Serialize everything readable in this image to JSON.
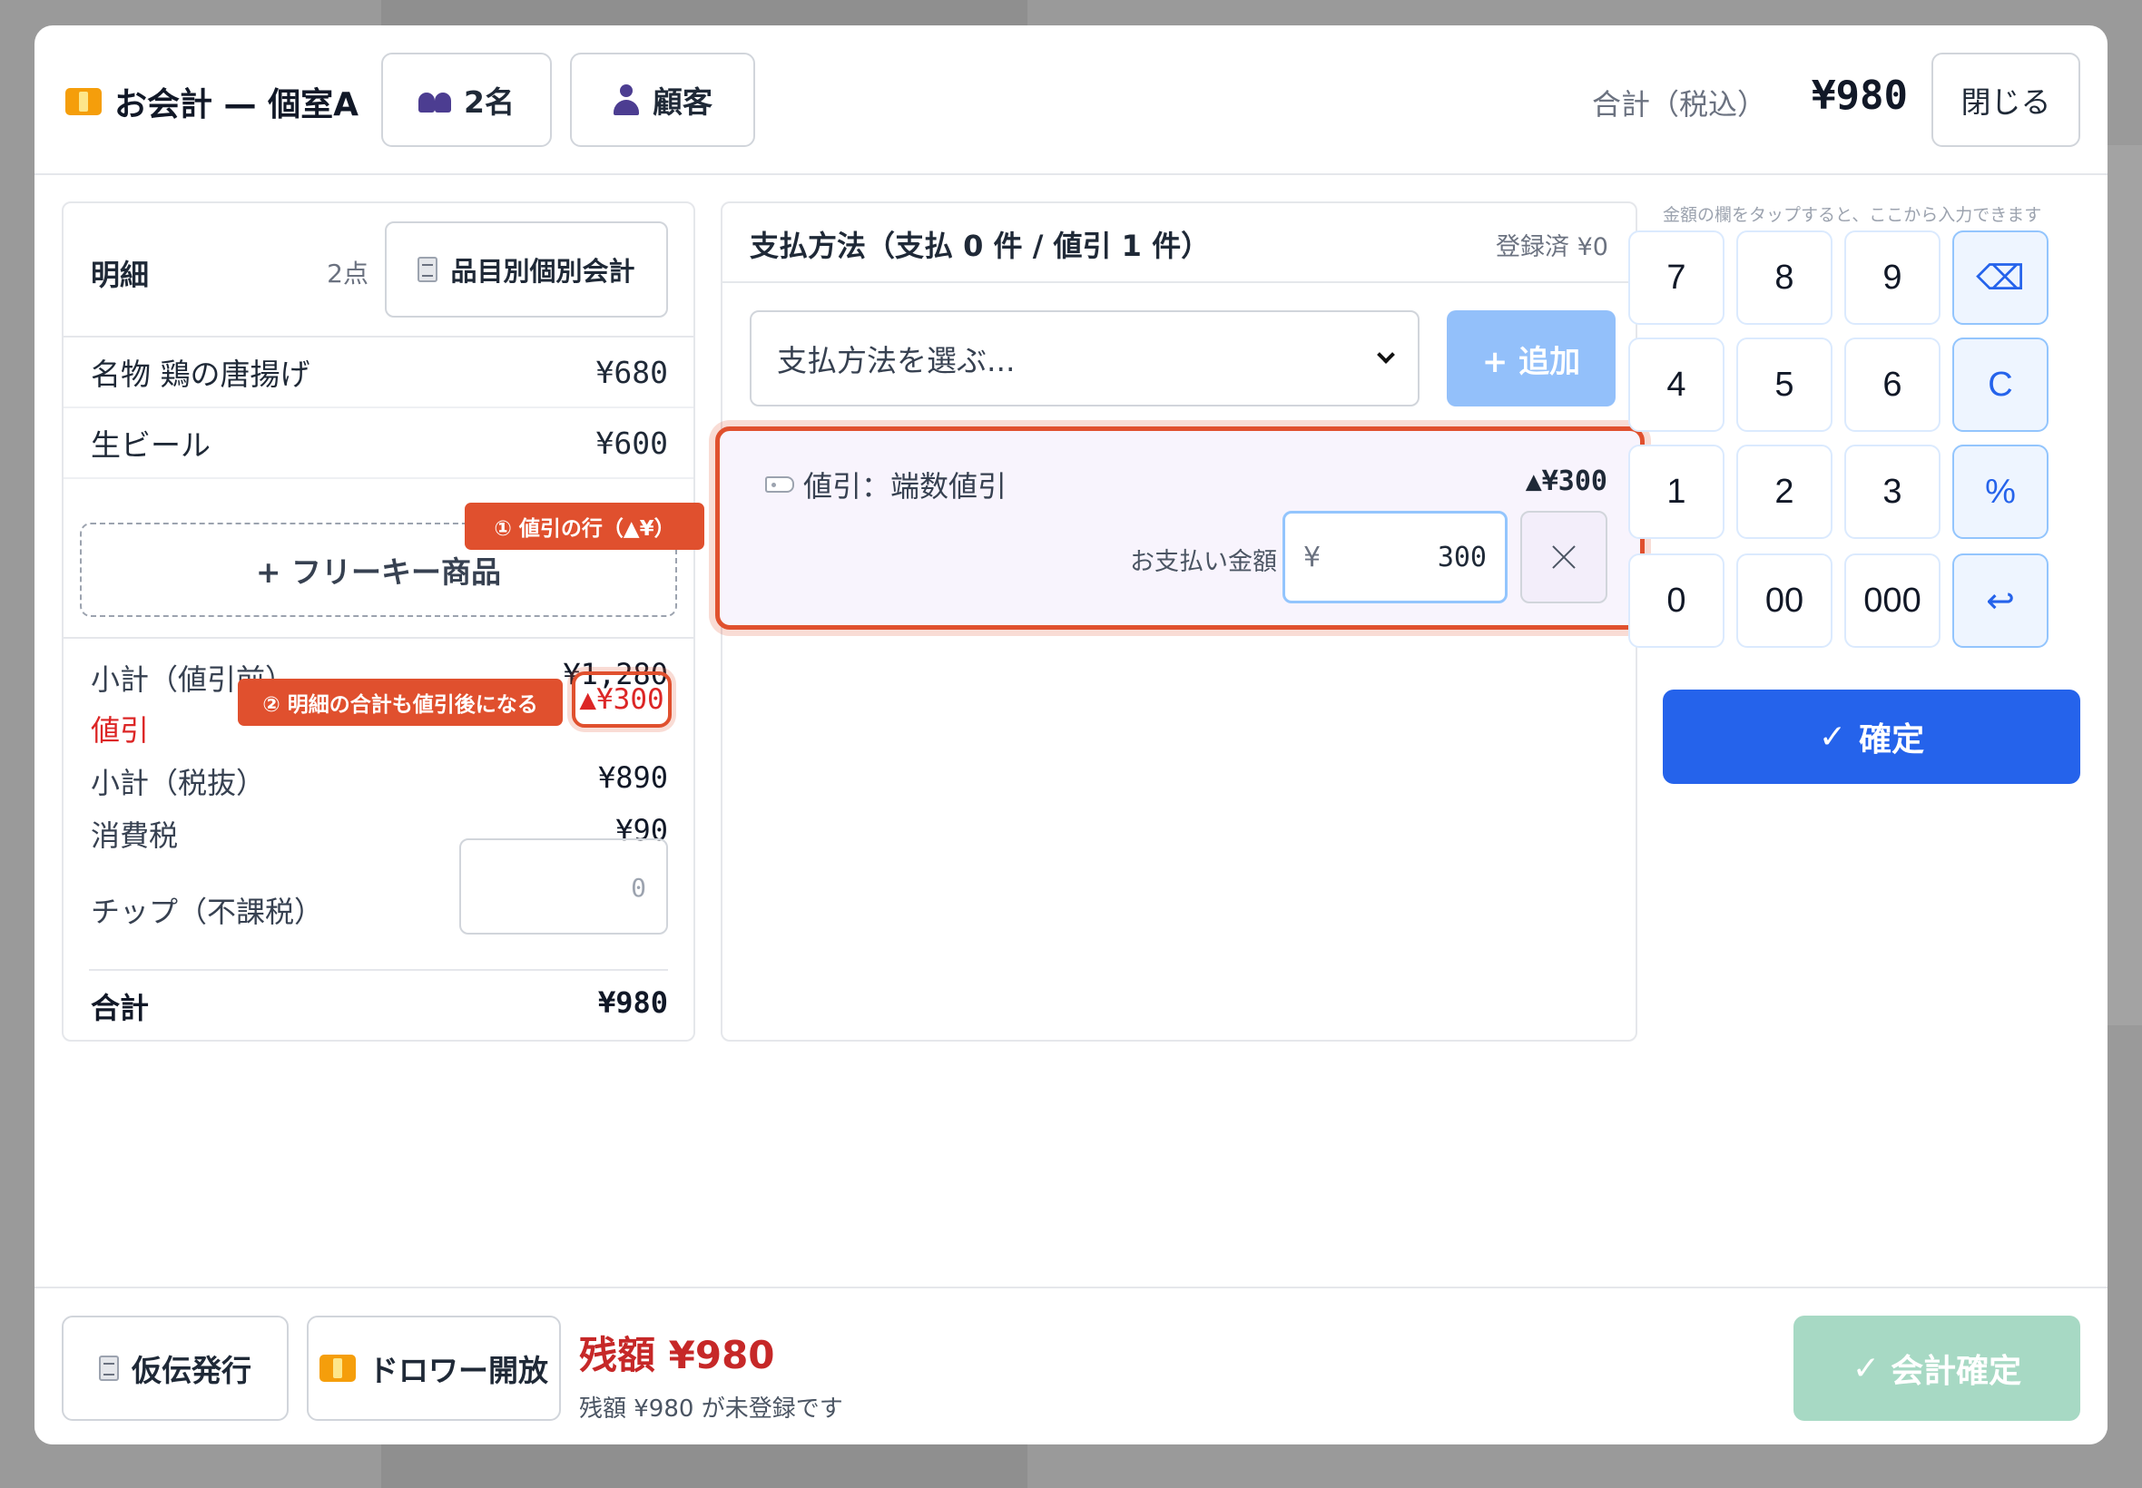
{
  "header": {
    "title": "お会計 — 個室A",
    "guests_label": "2名",
    "customer_label": "顧客",
    "total_label": "合計（税込）",
    "total_value": "¥980",
    "close_label": "閉じる"
  },
  "items_panel": {
    "title": "明細",
    "count": "2点",
    "split_label": "品目別個別会計",
    "items": [
      {
        "name": "名物 鶏の唐揚げ",
        "price": "¥680"
      },
      {
        "name": "生ビール",
        "price": "¥600"
      }
    ],
    "free_key_label": "+ フリーキー商品",
    "summary": {
      "subtotal_before_label": "小計（値引前）",
      "subtotal_before_value": "¥1,280",
      "discount_label": "値引",
      "discount_value": "▲¥300",
      "subtotal_ex_label": "小計（税抜）",
      "subtotal_ex_value": "¥890",
      "tax_label": "消費税",
      "tax_value": "¥90",
      "tip_label": "チップ（不課税）",
      "tip_placeholder": "0",
      "total_label": "合計",
      "total_value": "¥980"
    }
  },
  "annotations": {
    "note1": "① 値引の行（▲¥）",
    "note2": "② 明細の合計も値引後になる"
  },
  "payment_panel": {
    "title": "支払方法（支払 0 件 / 値引 1 件）",
    "registered": "登録済 ¥0",
    "select_placeholder": "支払方法を選ぶ...",
    "add_label": "+ 追加",
    "discount_entry": {
      "name": "値引：端数値引",
      "amount": "▲¥300",
      "pay_label": "お支払い金額",
      "currency": "¥",
      "input_value": "300"
    }
  },
  "keypad": {
    "hint": "金額の欄をタップすると、ここから入力できます",
    "keys": [
      "7",
      "8",
      "9",
      "⌫",
      "4",
      "5",
      "6",
      "C",
      "1",
      "2",
      "3",
      "%",
      "0",
      "00",
      "000",
      "↩"
    ],
    "confirm_label": "確定"
  },
  "footer": {
    "provisional_label": "仮伝発行",
    "drawer_label": "ドロワー開放",
    "remaining_title": "残額 ¥980",
    "remaining_sub": "残額 ¥980 が未登録です",
    "checkout_label": "会計確定"
  },
  "colors": {
    "accent": "#2563eb",
    "annotation": "#e0502e",
    "discount_red": "#dc2626",
    "remaining_red": "#c62828",
    "checkout_disabled": "#a7d9c4"
  }
}
